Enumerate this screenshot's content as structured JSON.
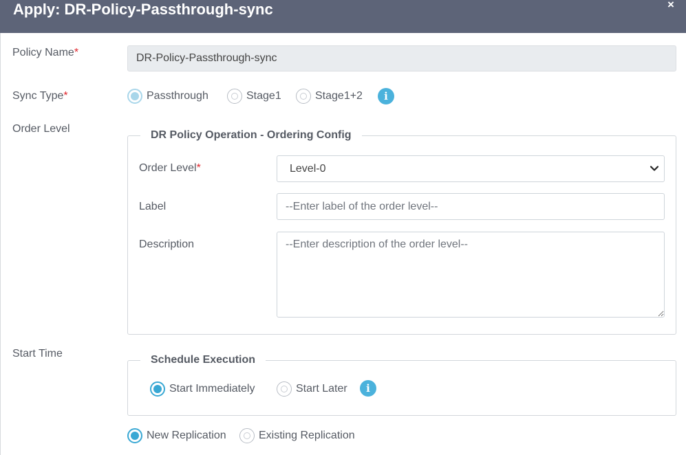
{
  "modal": {
    "title": "Apply: DR-Policy-Passthrough-sync",
    "close_icon": "×"
  },
  "policy_name": {
    "label": "Policy Name",
    "required_mark": "*",
    "value": "DR-Policy-Passthrough-sync"
  },
  "sync_type": {
    "label": "Sync Type",
    "required_mark": "*",
    "options": [
      "Passthrough",
      "Stage1",
      "Stage1+2"
    ],
    "selected": "Passthrough",
    "info_icon": "i"
  },
  "order_level_section": {
    "label": "Order Level",
    "legend": "DR Policy Operation - Ordering Config",
    "order_level": {
      "label": "Order Level",
      "required_mark": "*",
      "selected_value": "Level-0"
    },
    "label_field": {
      "label": "Label",
      "placeholder": "--Enter label of the order level--"
    },
    "description_field": {
      "label": "Description",
      "placeholder": "--Enter description of the order level--"
    }
  },
  "start_time": {
    "label": "Start Time",
    "legend": "Schedule Execution",
    "options": [
      "Start Immediately",
      "Start Later"
    ],
    "selected": "Start Immediately",
    "info_icon": "i"
  },
  "replication": {
    "options": [
      "New Replication",
      "Existing Replication"
    ],
    "selected": "New Replication"
  },
  "colors": {
    "header_bg": "#5d6478",
    "accent": "#39a8d4",
    "required": "#e0262d"
  }
}
